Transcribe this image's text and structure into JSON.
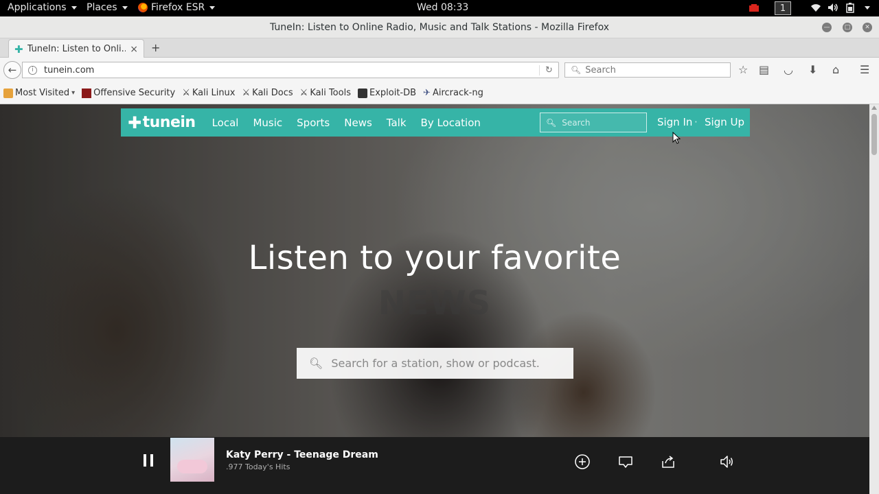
{
  "system_bar": {
    "applications": "Applications",
    "places": "Places",
    "app": "Firefox ESR",
    "clock": "Wed 08:33",
    "workspace": "1"
  },
  "window": {
    "title": "TuneIn: Listen to Online Radio, Music and Talk Stations - Mozilla Firefox"
  },
  "tab": {
    "label": "TuneIn: Listen to Onli...",
    "close": "×",
    "new_tab": "+"
  },
  "navbar": {
    "url": "tunein.com",
    "search_placeholder": "Search"
  },
  "bookmarks": [
    {
      "label": "Most Visited",
      "icon": "most-visited-icon"
    },
    {
      "label": "Offensive Security",
      "icon": "offsec-icon"
    },
    {
      "label": "Kali Linux",
      "icon": "kali-icon"
    },
    {
      "label": "Kali Docs",
      "icon": "kali-icon"
    },
    {
      "label": "Kali Tools",
      "icon": "kali-icon"
    },
    {
      "label": "Exploit-DB",
      "icon": "exploitdb-icon"
    },
    {
      "label": "Aircrack-ng",
      "icon": "aircrack-icon"
    }
  ],
  "tunein": {
    "logo": "tunein",
    "nav": [
      "Local",
      "Music",
      "Sports",
      "News",
      "Talk",
      "By Location"
    ],
    "search_placeholder": "Search",
    "sign_in": "Sign In",
    "separator": "·",
    "sign_up": "Sign Up",
    "accent": "#36b4a7"
  },
  "hero": {
    "title": "Listen to your favorite",
    "rotating_word": "NEWS",
    "search_placeholder": "Search for a station, show or podcast."
  },
  "player": {
    "track": "Katy Perry - Teenage Dream",
    "station": ".977 Today's Hits"
  }
}
